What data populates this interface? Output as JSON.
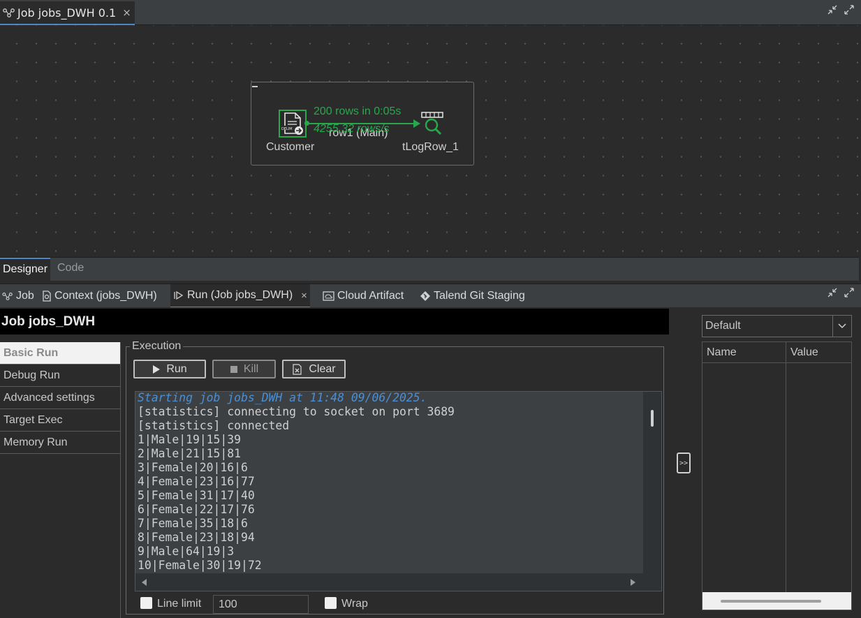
{
  "editor": {
    "tab_title": "Job jobs_DWH 0.1",
    "close_symbol": "×"
  },
  "designer": {
    "components": {
      "customer_label": "Customer",
      "customer_icon_badge": "DELIM",
      "logrow_label": "tLogRow_1"
    },
    "flow": {
      "stat_rows": "200 rows in 0:05s",
      "stat_rate": "4255.32 rows/s",
      "label": "row1 (Main)"
    },
    "tabs": {
      "designer": "Designer",
      "code": "Code"
    }
  },
  "bottom_tabs": {
    "job": "Job",
    "context": "Context (jobs_DWH)",
    "run": "Run (Job jobs_DWH)",
    "cloud": "Cloud Artifact",
    "git": "Talend Git Staging",
    "close_symbol": "×"
  },
  "run_panel": {
    "title": "Job jobs_DWH",
    "nav": [
      "Basic Run",
      "Debug Run",
      "Advanced settings",
      "Target Exec",
      "Memory Run"
    ],
    "execution": {
      "legend": "Execution",
      "run_label": "Run",
      "kill_label": "Kill",
      "clear_label": "Clear"
    },
    "console": {
      "start_line": "Starting job jobs_DWH at 11:48 09/06/2025.",
      "lines": [
        "[statistics] connecting to socket on port 3689",
        "[statistics] connected",
        "1|Male|19|15|39",
        "2|Male|21|15|81",
        "3|Female|20|16|6",
        "4|Female|23|16|77",
        "5|Female|31|17|40",
        "6|Female|22|17|76",
        "7|Female|35|18|6",
        "8|Female|23|18|94",
        "9|Male|64|19|3",
        "10|Female|30|19|72"
      ]
    },
    "line_limit_label": "Line limit",
    "line_limit_value": "100",
    "wrap_label": "Wrap",
    "toggle_label": ">>"
  },
  "context_panel": {
    "selected": "Default",
    "columns": [
      "Name",
      "Value"
    ]
  },
  "colors": {
    "flow_green": "#27a84a",
    "accent_blue": "#4a88c7",
    "console_highlight": "#4a8fd6"
  }
}
